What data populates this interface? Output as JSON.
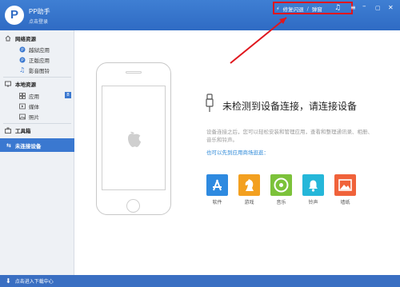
{
  "titlebar": {
    "app_title": "PP助手",
    "login_link": "点击登录",
    "repair_link": "修复闪退",
    "separator": "/",
    "popup_link": "弹窗",
    "icons": [
      "lightning-icon",
      "music-icon",
      "shirt-icon",
      "menu-icon",
      "minimize-icon",
      "maximize-icon",
      "close-icon"
    ]
  },
  "sidebar": {
    "section_online": "网络资源",
    "online_items": [
      {
        "label": "越狱应用",
        "icon": "p-app-icon"
      },
      {
        "label": "正版应用",
        "icon": "p-app-icon"
      },
      {
        "label": "影音图铃",
        "icon": "music-icon"
      }
    ],
    "section_local": "本地资源",
    "local_items": [
      {
        "label": "应用",
        "icon": "grid-icon",
        "badge": "8"
      },
      {
        "label": "媒体",
        "icon": "media-icon"
      },
      {
        "label": "照片",
        "icon": "photo-icon"
      }
    ],
    "toolbox": "工具箱",
    "device": "未连接设备"
  },
  "main": {
    "title": "未检测到设备连接，请连接设备",
    "desc": "设备连接之后，您可以轻松安装和管理应用，查看和整理通讯录、相册、音乐和铃声。",
    "store_link": "也可以先到应用商场逛逛：",
    "apps": [
      {
        "label": "软件",
        "color": "#2e8ae0"
      },
      {
        "label": "游戏",
        "color": "#f3a020"
      },
      {
        "label": "音乐",
        "color": "#7cc23a"
      },
      {
        "label": "铃声",
        "color": "#25b7d9"
      },
      {
        "label": "墙纸",
        "color": "#f0623a"
      }
    ]
  },
  "statusbar": {
    "text": "点击进入下载中心"
  },
  "colors": {
    "brand": "#2f6bc4",
    "annotation": "#e0161d"
  }
}
